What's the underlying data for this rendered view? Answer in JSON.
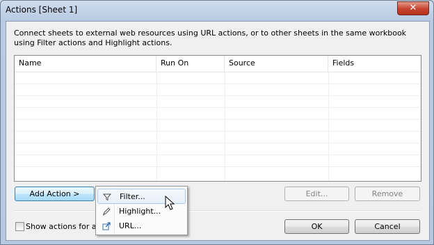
{
  "window": {
    "title": "Actions [Sheet 1]",
    "close_glyph": "✕"
  },
  "description": "Connect sheets to external web resources using URL actions, or to other sheets in the same workbook using Filter actions and Highlight actions.",
  "table": {
    "columns": [
      "Name",
      "Run On",
      "Source",
      "Fields"
    ],
    "rows": []
  },
  "buttons": {
    "add_action": "Add Action >",
    "edit": "Edit...",
    "remove": "Remove",
    "ok": "OK",
    "cancel": "Cancel"
  },
  "show_all_checkbox": {
    "label": "Show actions for all s",
    "checked": false
  },
  "add_action_menu": {
    "items": [
      {
        "label": "Filter...",
        "icon": "filter-icon",
        "highlighted": true
      },
      {
        "label": "Highlight...",
        "icon": "highlighter-pen-icon",
        "highlighted": false
      },
      {
        "label": "URL...",
        "icon": "external-link-icon",
        "highlighted": false
      }
    ]
  },
  "colors": {
    "title_bar": "#c4d4ea",
    "close_button": "#c5432e",
    "menu_highlight_border": "#a8c8ec",
    "active_button_border": "#3c7fb1"
  }
}
